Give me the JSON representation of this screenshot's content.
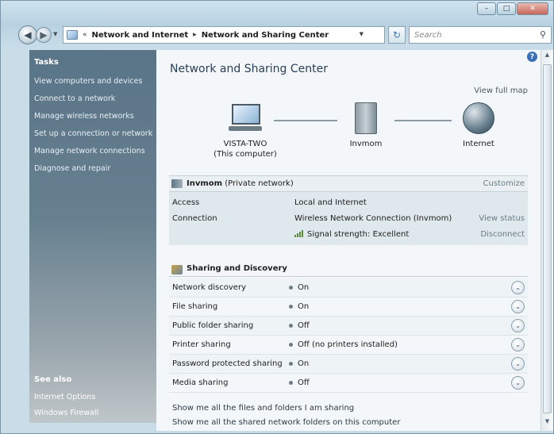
{
  "window": {
    "caption_buttons": [
      "–",
      "□",
      "✕"
    ]
  },
  "toolbar": {
    "back_glyph": "◀",
    "forward_glyph": "▶",
    "address_overflow": "«",
    "breadcrumb": [
      "Network and Internet",
      "Network and Sharing Center"
    ],
    "breadcrumb_sep": "▸",
    "refresh_glyph": "↻",
    "search_placeholder": "Search"
  },
  "tasks": {
    "heading": "Tasks",
    "items": [
      "View computers and devices",
      "Connect to a network",
      "Manage wireless networks",
      "Set up a connection or network",
      "Manage network connections",
      "Diagnose and repair"
    ],
    "see_also_heading": "See also",
    "see_also_items": [
      "Internet Options",
      "Windows Firewall"
    ]
  },
  "main": {
    "title": "Network and Sharing Center",
    "view_full_map": "View full map",
    "help_glyph": "?",
    "map": {
      "computer_name": "VISTA-TWO",
      "computer_sub": "(This computer)",
      "router_name": "Invmom",
      "internet_name": "Internet"
    },
    "network": {
      "name": "Invmom",
      "type": "(Private network)",
      "customize": "Customize",
      "rows": [
        {
          "key": "Access",
          "value": "Local and Internet",
          "action": ""
        },
        {
          "key": "Connection",
          "value": "Wireless Network Connection (Invmom)",
          "action": "View status"
        },
        {
          "key": "",
          "value": "Signal strength:  Excellent",
          "action": "Disconnect"
        }
      ]
    },
    "sharing": {
      "title": "Sharing and Discovery",
      "rows": [
        {
          "key": "Network discovery",
          "value": "On"
        },
        {
          "key": "File sharing",
          "value": "On"
        },
        {
          "key": "Public folder sharing",
          "value": "Off"
        },
        {
          "key": "Printer sharing",
          "value": "Off (no printers installed)"
        },
        {
          "key": "Password protected sharing",
          "value": "On"
        },
        {
          "key": "Media sharing",
          "value": "Off"
        }
      ],
      "expand_glyph": "⌄"
    },
    "footer_links": [
      "Show me all the files and folders I am sharing",
      "Show me all the shared network folders on this computer"
    ]
  }
}
